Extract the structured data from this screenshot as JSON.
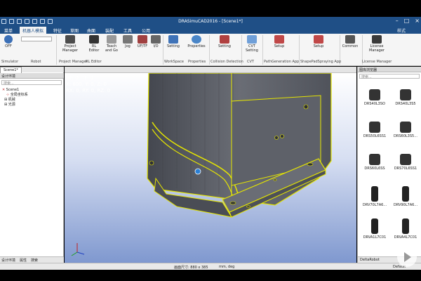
{
  "app": {
    "title": "DRASimuCAD2016 - [Scene1*]"
  },
  "menu": {
    "items": [
      "菜单",
      "机器人模拟",
      "特征",
      "草图",
      "曲面",
      "装配",
      "工具",
      "公用"
    ],
    "active_index": 1,
    "style_label": "样式"
  },
  "ribbon": {
    "buttons": [
      {
        "label": "OFF",
        "icon": "power-icon"
      },
      {
        "label": "Project Manager",
        "icon": "project-manager-icon"
      },
      {
        "label": "RL Editor",
        "icon": "rl-editor-icon"
      },
      {
        "label": "Teach and Go",
        "icon": "teach-icon"
      },
      {
        "label": "Jog",
        "icon": "jog-icon"
      },
      {
        "label": "UF/TF",
        "icon": "frame-icon"
      },
      {
        "label": "I/O",
        "icon": "io-icon"
      },
      {
        "label": "Setting",
        "icon": "workspace-setting-icon"
      },
      {
        "label": "Properties",
        "icon": "gear-icon"
      },
      {
        "label": "Setting",
        "icon": "collision-setting-icon"
      },
      {
        "label": "CVT Setting",
        "icon": "cvt-icon"
      },
      {
        "label": "Setup",
        "icon": "path-setup-icon"
      },
      {
        "label": "Setup",
        "icon": "spray-setup-icon"
      },
      {
        "label": "Common",
        "icon": "common-icon"
      },
      {
        "label": "License Manager",
        "icon": "license-icon"
      }
    ],
    "groups": [
      "Simulator",
      "Robot",
      "Project Manager",
      "RL Editor",
      "WorkSpace",
      "Properties",
      "Collision Detection",
      "CVT",
      "PathGeneration App",
      "ShapePadSpraying App",
      "License Manager"
    ]
  },
  "left_panel": {
    "tab": "Scene1*",
    "header": "设计环境",
    "search_placeholder": "搜索...",
    "tree": [
      "Scene1",
      "全局坐标系",
      "机械",
      "光源"
    ],
    "bottom_tabs": [
      "设计环境",
      "属性",
      "搜索"
    ]
  },
  "viewport": {
    "coords": [
      "UF: 0, TF: 0",
      "X: 600, Y: 0, Z: 0",
      "RX: 0, RY: 0, RZ: 0"
    ]
  },
  "right_panel": {
    "header": "图库浏览器",
    "search_placeholder": "搜索...",
    "items": [
      "DRS40L3SO",
      "DRS40L3S5",
      "DRS50L6SS1",
      "DRS60L3S5...",
      "DRS60L6SS",
      "DRS70L6SS1",
      "DRV70L7A6...",
      "DRV90L7A6...",
      "DRVA1L7C01",
      "DRVA4L7C01"
    ],
    "footer_tab": "DeltaRobot"
  },
  "status": {
    "left": "画面尺寸: 880 x 385",
    "right": "mm, deg",
    "default": "Default"
  },
  "colors": {
    "title_blue": "#1f4f86",
    "outline_yellow": "#e6e600",
    "model_grey": "#5d6068"
  }
}
